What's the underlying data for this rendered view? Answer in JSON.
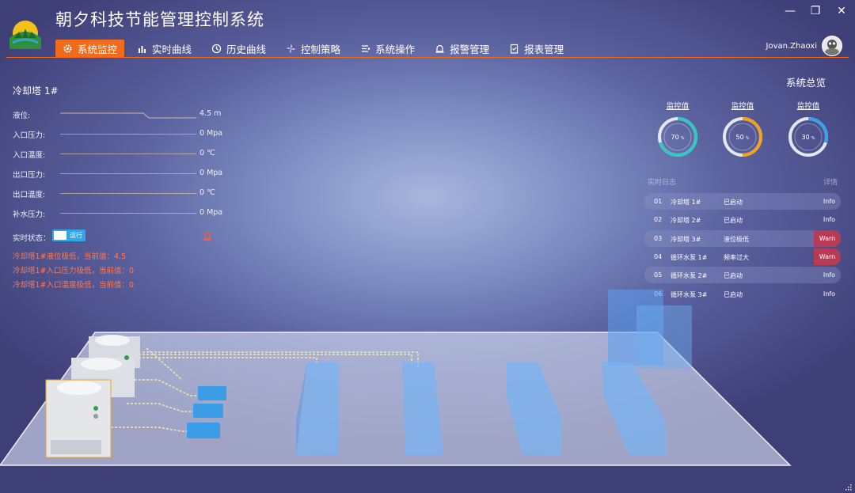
{
  "app": {
    "title": "朝夕科技节能管理控制系统",
    "user": "Jovan.Zhaoxi"
  },
  "nav": [
    {
      "label": "系统监控",
      "icon": "gear-icon",
      "active": true
    },
    {
      "label": "实时曲线",
      "icon": "bar-chart-icon",
      "active": false
    },
    {
      "label": "历史曲线",
      "icon": "history-icon",
      "active": false
    },
    {
      "label": "控制策略",
      "icon": "fan-icon",
      "active": false
    },
    {
      "label": "系统操作",
      "icon": "operation-icon",
      "active": false
    },
    {
      "label": "报警管理",
      "icon": "alarm-icon",
      "active": false
    },
    {
      "label": "报表管理",
      "icon": "report-icon",
      "active": false
    }
  ],
  "device": {
    "title": "冷却塔 1#",
    "params": [
      {
        "label": "液位:",
        "value": "4.5 m"
      },
      {
        "label": "入口压力:",
        "value": "0 Mpa"
      },
      {
        "label": "入口温度:",
        "value": "0 ℃"
      },
      {
        "label": "出口压力:",
        "value": "0 Mpa"
      },
      {
        "label": "出口温度:",
        "value": "0 ℃"
      },
      {
        "label": "补水压力:",
        "value": "0 Mpa"
      }
    ],
    "status_label": "实时状态：",
    "status_value": "运行",
    "alerts": [
      "冷却塔1#液位极低，当前值：4.5",
      "冷却塔1#入口压力极低，当前值：0",
      "冷却塔1#入口温度极低，当前值：0"
    ]
  },
  "overview": {
    "title": "系统总览",
    "gauges": [
      {
        "label": "监控值",
        "value": 70,
        "text": "70",
        "unit": "%",
        "color": "#36c6c0"
      },
      {
        "label": "监控值",
        "value": 50,
        "text": "50",
        "unit": "%",
        "color": "#f2a21e"
      },
      {
        "label": "监控值",
        "value": 30,
        "text": "30",
        "unit": "%",
        "color": "#3aa2e8"
      }
    ],
    "log_header_left": "实时日志",
    "log_header_right": "详情",
    "logs": [
      {
        "no": "01",
        "device": "冷却塔 1#",
        "status": "已启动",
        "level": "Info"
      },
      {
        "no": "02",
        "device": "冷却塔 2#",
        "status": "已启动",
        "level": "Info"
      },
      {
        "no": "03",
        "device": "冷却塔 3#",
        "status": "液位极低",
        "level": "Warn"
      },
      {
        "no": "04",
        "device": "循环水泵 1#",
        "status": "频率过大",
        "level": "Warn"
      },
      {
        "no": "05",
        "device": "循环水泵 2#",
        "status": "已启动",
        "level": "Info"
      },
      {
        "no": "06",
        "device": "循环水泵 3#",
        "status": "已启动",
        "level": "Info"
      }
    ]
  },
  "colors": {
    "accent": "#f26b1d",
    "warn": "#b83a54",
    "alert_text": "#ff7a55"
  }
}
